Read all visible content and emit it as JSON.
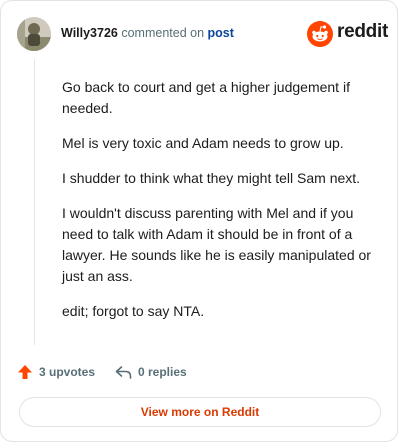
{
  "header": {
    "username": "Willy3726",
    "commented_on": "commented on",
    "post_link": "post",
    "logo_text": "reddit"
  },
  "comment": {
    "paragraphs": [
      "Go back to court and get a higher judgement if needed.",
      "Mel is very toxic and Adam needs to grow up.",
      "I shudder to think what they might tell Sam next.",
      "I wouldn't discuss parenting with Mel and if you need to talk with Adam it should be in front of a lawyer. He sounds like he is easily manipulated or just an ass.",
      "edit; forgot to say NTA."
    ]
  },
  "actions": {
    "upvotes": "3 upvotes",
    "replies": "0 replies"
  },
  "footer": {
    "view_more": "View more on Reddit"
  },
  "colors": {
    "accent": "#ff4500",
    "link": "#0a449b",
    "muted": "#576f76",
    "button_text": "#d93a00"
  },
  "icons": [
    "avatar",
    "reddit-logo-icon",
    "upvote-arrow-icon",
    "reply-icon"
  ]
}
